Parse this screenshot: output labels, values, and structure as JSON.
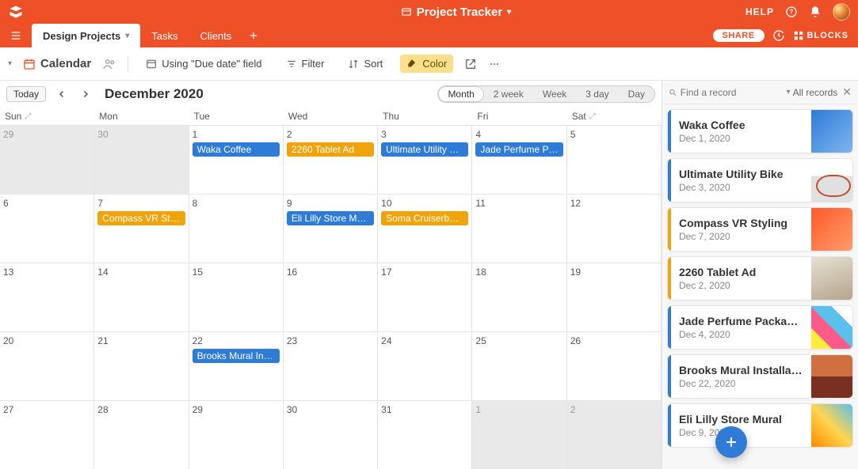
{
  "brand": {
    "title": "Project Tracker"
  },
  "topbar": {
    "help_label": "HELP"
  },
  "nav": {
    "tabs": [
      {
        "label": "Design Projects",
        "active": true,
        "has_dropdown": true
      },
      {
        "label": "Tasks",
        "active": false
      },
      {
        "label": "Clients",
        "active": false
      }
    ],
    "share_label": "SHARE",
    "blocks_label": "BLOCKS"
  },
  "toolbar": {
    "view_label": "Calendar",
    "using_label": "Using \"Due date\" field",
    "filter_label": "Filter",
    "sort_label": "Sort",
    "color_label": "Color"
  },
  "calendar": {
    "today_label": "Today",
    "month_title": "December 2020",
    "view_options": [
      "Month",
      "2 week",
      "Week",
      "3 day",
      "Day"
    ],
    "active_view": "Month",
    "day_headers": [
      "Sun",
      "Mon",
      "Tue",
      "Wed",
      "Thu",
      "Fri",
      "Sat"
    ],
    "cells": [
      {
        "num": "29",
        "out": true
      },
      {
        "num": "30",
        "out": true
      },
      {
        "num": "1",
        "events": [
          {
            "label": "Waka Coffee",
            "color": "blue"
          }
        ]
      },
      {
        "num": "2",
        "events": [
          {
            "label": "2260 Tablet Ad",
            "color": "orange"
          }
        ]
      },
      {
        "num": "3",
        "events": [
          {
            "label": "Ultimate Utility Bike",
            "color": "blue"
          }
        ]
      },
      {
        "num": "4",
        "events": [
          {
            "label": "Jade Perfume Pac...",
            "color": "blue"
          }
        ]
      },
      {
        "num": "5"
      },
      {
        "num": "6"
      },
      {
        "num": "7",
        "events": [
          {
            "label": "Compass VR Styli...",
            "color": "orange"
          }
        ]
      },
      {
        "num": "8"
      },
      {
        "num": "9",
        "events": [
          {
            "label": "Eli Lilly Store Mural",
            "color": "blue"
          }
        ]
      },
      {
        "num": "10",
        "events": [
          {
            "label": "Soma Cruiserboard",
            "color": "orange"
          }
        ]
      },
      {
        "num": "11"
      },
      {
        "num": "12"
      },
      {
        "num": "13"
      },
      {
        "num": "14"
      },
      {
        "num": "15"
      },
      {
        "num": "16"
      },
      {
        "num": "17"
      },
      {
        "num": "18"
      },
      {
        "num": "19"
      },
      {
        "num": "20"
      },
      {
        "num": "21"
      },
      {
        "num": "22",
        "events": [
          {
            "label": "Brooks Mural Inst...",
            "color": "blue"
          }
        ]
      },
      {
        "num": "23"
      },
      {
        "num": "24"
      },
      {
        "num": "25"
      },
      {
        "num": "26"
      },
      {
        "num": "27"
      },
      {
        "num": "28"
      },
      {
        "num": "29"
      },
      {
        "num": "30"
      },
      {
        "num": "31"
      },
      {
        "num": "1",
        "out": true
      },
      {
        "num": "2",
        "out": true
      }
    ]
  },
  "sidebar": {
    "search_placeholder": "Find a record",
    "filter_label": "All records",
    "records": [
      {
        "title": "Waka Coffee",
        "date": "Dec 1, 2020",
        "color": "blue",
        "thumb": "t0"
      },
      {
        "title": "Ultimate Utility Bike",
        "date": "Dec 3, 2020",
        "color": "blue",
        "thumb": "t1"
      },
      {
        "title": "Compass VR Styling",
        "date": "Dec 7, 2020",
        "color": "orange",
        "thumb": "t2"
      },
      {
        "title": "2260 Tablet Ad",
        "date": "Dec 2, 2020",
        "color": "orange",
        "thumb": "t3"
      },
      {
        "title": "Jade Perfume Packaging",
        "date": "Dec 4, 2020",
        "color": "blue",
        "thumb": "t4"
      },
      {
        "title": "Brooks Mural Installation",
        "date": "Dec 22, 2020",
        "color": "blue",
        "thumb": "t5"
      },
      {
        "title": "Eli Lilly Store Mural",
        "date": "Dec 9, 2020",
        "color": "blue",
        "thumb": "t6"
      }
    ]
  }
}
